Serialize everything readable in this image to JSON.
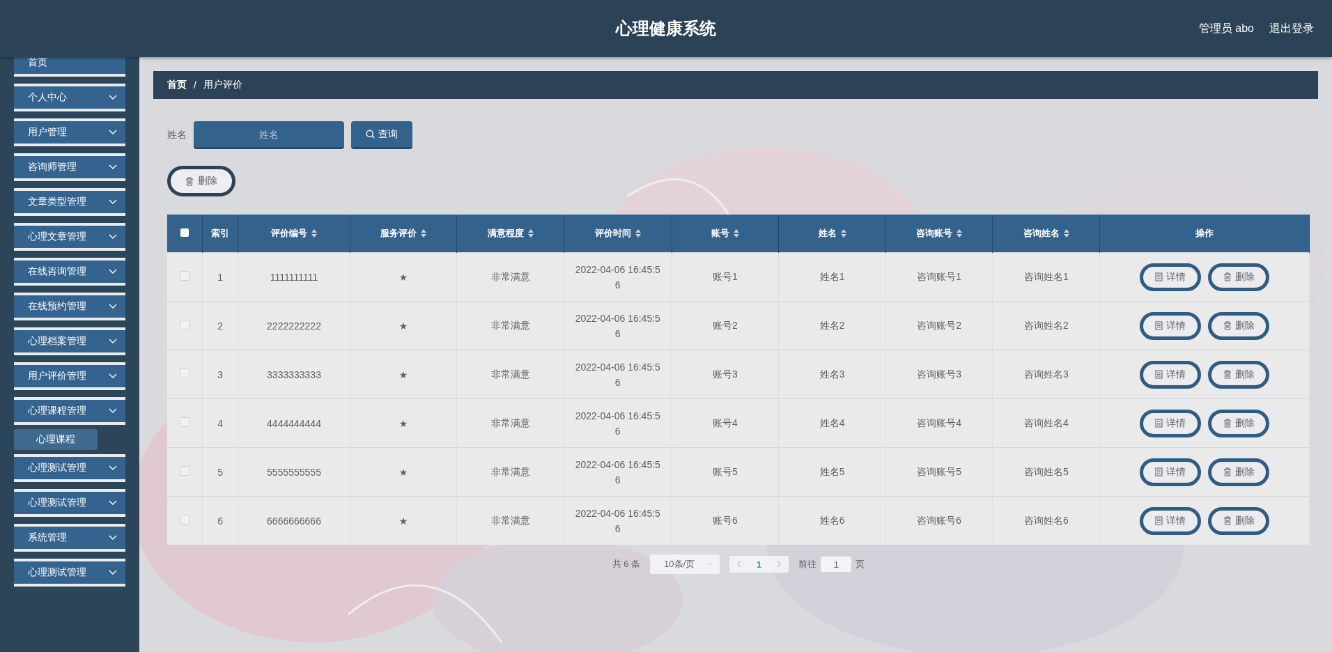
{
  "header": {
    "title": "心理健康系统",
    "user": "管理员 abo",
    "logout": "退出登录"
  },
  "sidebar": {
    "items": [
      {
        "label": "首页",
        "kind": "link"
      },
      {
        "label": "个人中心",
        "kind": "menu"
      },
      {
        "label": "用户管理",
        "kind": "menu"
      },
      {
        "label": "咨询师管理",
        "kind": "menu"
      },
      {
        "label": "文章类型管理",
        "kind": "menu"
      },
      {
        "label": "心理文章管理",
        "kind": "menu"
      },
      {
        "label": "在线咨询管理",
        "kind": "menu"
      },
      {
        "label": "在线预约管理",
        "kind": "menu"
      },
      {
        "label": "心理档案管理",
        "kind": "menu"
      },
      {
        "label": "用户评价管理",
        "kind": "menu"
      },
      {
        "label": "心理课程管理",
        "kind": "menu",
        "children": [
          {
            "label": "心理课程"
          }
        ]
      },
      {
        "label": "心理测试管理",
        "kind": "menu"
      },
      {
        "label": "心理测试管理",
        "kind": "menu"
      },
      {
        "label": "系统管理",
        "kind": "menu"
      },
      {
        "label": "心理测试管理",
        "kind": "menu"
      }
    ]
  },
  "breadcrumb": [
    "首页",
    "/",
    "用户评价"
  ],
  "search": {
    "label": "姓名",
    "placeholder": "姓名",
    "button": "查询"
  },
  "delete_button": "删除",
  "table": {
    "select_all": {
      "checked": false
    },
    "columns": [
      {
        "label": "索引",
        "sortable": false
      },
      {
        "label": "评价编号",
        "sortable": true
      },
      {
        "label": "服务评价",
        "sortable": true
      },
      {
        "label": "满意程度",
        "sortable": true
      },
      {
        "label": "评价时间",
        "sortable": true
      },
      {
        "label": "账号",
        "sortable": true
      },
      {
        "label": "姓名",
        "sortable": true
      },
      {
        "label": "咨询账号",
        "sortable": true
      },
      {
        "label": "咨询姓名",
        "sortable": true
      },
      {
        "label": "操作",
        "sortable": false
      }
    ],
    "rows": [
      {
        "checked": false,
        "cells": [
          "1",
          "1111111111",
          "★",
          "非常满意",
          "2022-04-06 16:45:56",
          "账号1",
          "姓名1",
          "咨询账号1",
          "咨询姓名1"
        ],
        "actions": [
          "详情",
          "删除"
        ]
      },
      {
        "checked": false,
        "cells": [
          "2",
          "2222222222",
          "★",
          "非常满意",
          "2022-04-06 16:45:56",
          "账号2",
          "姓名2",
          "咨询账号2",
          "咨询姓名2"
        ],
        "actions": [
          "详情",
          "删除"
        ]
      },
      {
        "checked": false,
        "cells": [
          "3",
          "3333333333",
          "★",
          "非常满意",
          "2022-04-06 16:45:56",
          "账号3",
          "姓名3",
          "咨询账号3",
          "咨询姓名3"
        ],
        "actions": [
          "详情",
          "删除"
        ]
      },
      {
        "checked": false,
        "cells": [
          "4",
          "4444444444",
          "★",
          "非常满意",
          "2022-04-06 16:45:56",
          "账号4",
          "姓名4",
          "咨询账号4",
          "咨询姓名4"
        ],
        "actions": [
          "详情",
          "删除"
        ]
      },
      {
        "checked": false,
        "cells": [
          "5",
          "5555555555",
          "★",
          "非常满意",
          "2022-04-06 16:45:56",
          "账号5",
          "姓名5",
          "咨询账号5",
          "咨询姓名5"
        ],
        "actions": [
          "详情",
          "删除"
        ]
      },
      {
        "checked": false,
        "cells": [
          "6",
          "6666666666",
          "★",
          "非常满意",
          "2022-04-06 16:45:56",
          "账号6",
          "姓名6",
          "咨询账号6",
          "咨询姓名6"
        ],
        "actions": [
          "详情",
          "删除"
        ]
      }
    ]
  },
  "pagination": {
    "total": "共 6 条",
    "page_size": "10条/页",
    "current_page": "1",
    "goto_label": "前往",
    "goto_value": "1",
    "page_suffix": "页"
  }
}
